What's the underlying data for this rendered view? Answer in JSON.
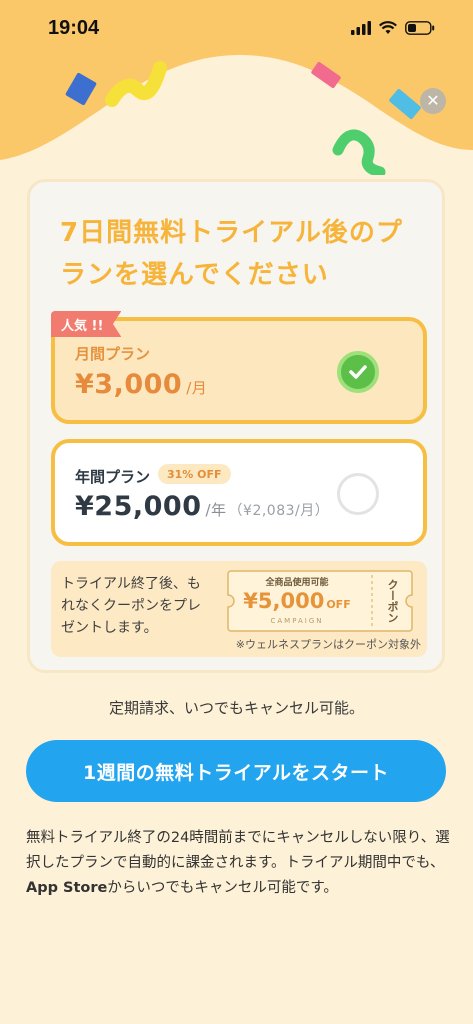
{
  "status_bar": {
    "time": "19:04"
  },
  "colors": {
    "background": "#fdf1d7",
    "header": "#fbc869",
    "accent_orange": "#f7b43a",
    "selected_border": "#f6bf43",
    "check_green": "#5bbf48",
    "cta_blue": "#23a4ee",
    "badge_red": "#f07b6e"
  },
  "header": {
    "close_icon": "close-icon"
  },
  "card": {
    "title": "7日間無料トライアル後のプランを選んでください"
  },
  "plans": {
    "monthly": {
      "badge": "人気 !!",
      "name": "月間プラン",
      "price": "¥3,000",
      "unit": "/月",
      "selected": true
    },
    "yearly": {
      "badge": "31% OFF",
      "name": "年間プラン",
      "price": "¥25,000",
      "unit": "/年",
      "sub": "（¥2,083/月）",
      "selected": false
    }
  },
  "coupon": {
    "text": "トライアル終了後、もれなくクーポンをプレゼントします。",
    "ticket_top": "全商品使用可能",
    "ticket_amount": "¥5,000",
    "ticket_off": "OFF",
    "ticket_campaign": "CAMPAIGN",
    "ticket_side": "クーポン",
    "note": "※ウェルネスプランはクーポン対象外"
  },
  "renewal_text": "定期請求、いつでもキャンセル可能。",
  "cta_label": "1週間の無料トライアルをスタート",
  "disclaimer": {
    "before": "無料トライアル終了の24時間前までにキャンセルしない限り、選択したプランで自動的に課金されます。トライアル期間中でも、",
    "bold": "App Store",
    "after": "からいつでもキャンセル可能です。"
  }
}
